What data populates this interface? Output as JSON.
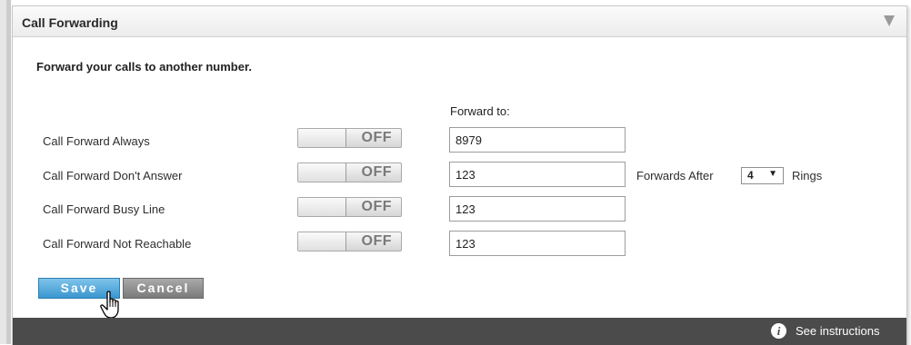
{
  "panel": {
    "title": "Call Forwarding",
    "description": "Forward your calls to another number.",
    "forward_to_header": "Forward to:"
  },
  "rows": [
    {
      "label": "Call Forward Always",
      "toggle": "OFF",
      "number": "8979"
    },
    {
      "label": "Call Forward Don't Answer",
      "toggle": "OFF",
      "number": "123"
    },
    {
      "label": "Call Forward Busy Line",
      "toggle": "OFF",
      "number": "123"
    },
    {
      "label": "Call Forward Not Reachable",
      "toggle": "OFF",
      "number": "123"
    }
  ],
  "rings": {
    "prefix": "Forwards After",
    "value": "4",
    "arrow": "▼",
    "suffix": "Rings"
  },
  "buttons": {
    "save": "Save",
    "cancel": "Cancel"
  },
  "footer": {
    "info_glyph": "i",
    "instructions_link": "See instructions"
  },
  "icons": {
    "collapse": "chevron-down-icon",
    "info": "info-icon",
    "cursor": "hand-pointer-icon"
  },
  "colors": {
    "save_button": "#3a96cf",
    "cancel_button": "#7b7b7b",
    "footer_bg": "#4b4b4b"
  }
}
